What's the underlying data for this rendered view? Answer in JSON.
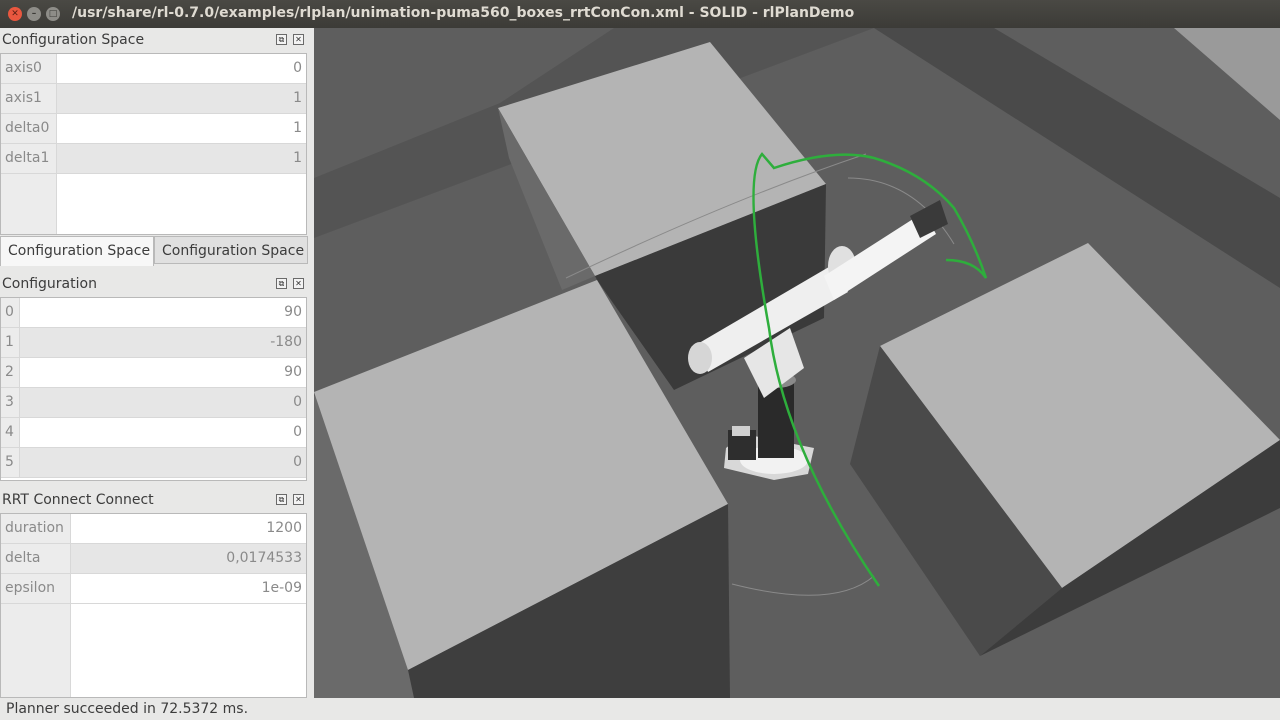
{
  "window": {
    "title": "/usr/share/rl-0.7.0/examples/rlplan/unimation-puma560_boxes_rrtConCon.xml - SOLID - rlPlanDemo"
  },
  "config_space_panel": {
    "title": "Configuration Space",
    "rows": [
      {
        "label": "axis0",
        "value": "0"
      },
      {
        "label": "axis1",
        "value": "1"
      },
      {
        "label": "delta0",
        "value": "1"
      },
      {
        "label": "delta1",
        "value": "1"
      }
    ],
    "tabs": [
      "Configuration Space",
      "Configuration Space"
    ]
  },
  "configuration_panel": {
    "title": "Configuration",
    "rows": [
      {
        "label": "0",
        "value": "90"
      },
      {
        "label": "1",
        "value": "-180"
      },
      {
        "label": "2",
        "value": "90"
      },
      {
        "label": "3",
        "value": "0"
      },
      {
        "label": "4",
        "value": "0"
      },
      {
        "label": "5",
        "value": "0"
      }
    ]
  },
  "planner_panel": {
    "title": "RRT Connect Connect",
    "rows": [
      {
        "label": "duration",
        "value": "1200"
      },
      {
        "label": "delta",
        "value": "0,0174533"
      },
      {
        "label": "epsilon",
        "value": "1e-09"
      }
    ]
  },
  "status": {
    "text": "Planner succeeded in 72.5372 ms."
  },
  "colors": {
    "path": "#2eae3c",
    "floor": "#5e5e5e",
    "box_top": "#b4b4b4"
  }
}
